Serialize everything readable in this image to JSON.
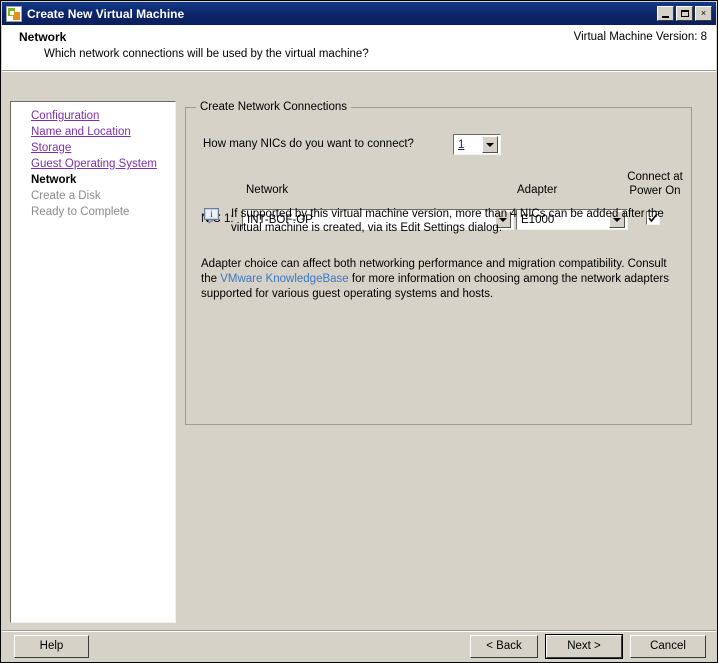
{
  "window": {
    "title": "Create New Virtual Machine",
    "icon": "vm-app-icon",
    "controls": {
      "minimize": "minimize-icon",
      "maximize": "maximize-icon",
      "close": "×"
    }
  },
  "header": {
    "title": "Network",
    "subtitle": "Which network connections will be used by the virtual machine?",
    "version_label": "Virtual Machine Version: 8"
  },
  "sidebar": {
    "items": [
      {
        "label": "Configuration",
        "state": "link"
      },
      {
        "label": "Name and Location",
        "state": "link"
      },
      {
        "label": "Storage",
        "state": "link"
      },
      {
        "label": "Guest Operating System",
        "state": "link"
      },
      {
        "label": "Network",
        "state": "current"
      },
      {
        "label": "Create a Disk",
        "state": "pending"
      },
      {
        "label": "Ready to Complete",
        "state": "pending"
      }
    ]
  },
  "main": {
    "groupbox_title": "Create Network Connections",
    "nic_count_question": "How many NICs do you want to connect?",
    "nic_count_value": "1",
    "columns": {
      "network": "Network",
      "adapter": "Adapter",
      "connect_at_power_on_line1": "Connect at",
      "connect_at_power_on_line2": "Power On"
    },
    "rows": [
      {
        "nic_label": "NIC 1:",
        "network": "INT-BOF-OP",
        "adapter": "E1000",
        "connect_at_power_on": true
      }
    ],
    "note": {
      "icon": "info-tip-icon",
      "text": "If supported by this virtual machine version, more than 4 NICs can be added after the virtual machine is created, via its Edit Settings dialog."
    },
    "paragraph": {
      "before_link": "Adapter choice can affect both networking performance and migration compatibility. Consult the ",
      "link": "VMware KnowledgeBase",
      "after_link": " for more information on choosing among the network adapters supported for various guest operating systems and hosts."
    }
  },
  "footer": {
    "help": "Help",
    "back": "< Back",
    "next": "Next >",
    "cancel": "Cancel"
  },
  "colors": {
    "titlebar": "#0d2468",
    "dialog_face": "#d6d2c7",
    "link_visited": "#7c2fa8",
    "link_blue": "#3b78c3",
    "disabled_text": "#8a8a8a"
  }
}
